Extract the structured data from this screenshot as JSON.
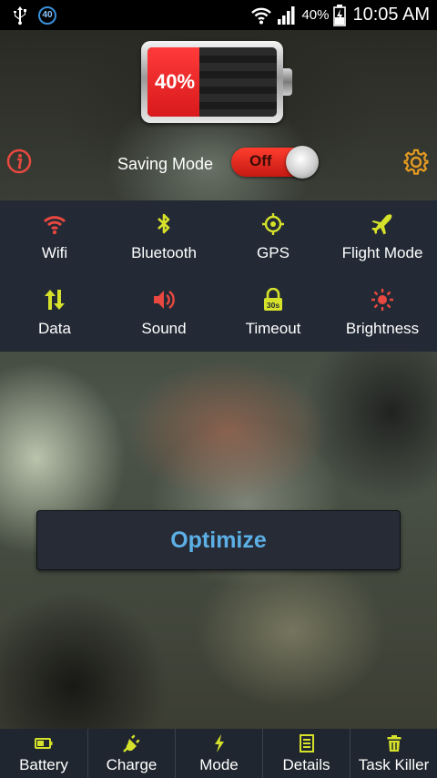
{
  "status_bar": {
    "notification_count": "40",
    "battery_percent": "40%",
    "time": "10:05 AM"
  },
  "battery": {
    "level_fraction": 0.4,
    "percent_label": "40%"
  },
  "saving_mode": {
    "label": "Saving Mode",
    "toggle_label": "Off"
  },
  "quick_settings": [
    {
      "label": "Wifi",
      "icon": "wifi-icon",
      "color": "#e8483f"
    },
    {
      "label": "Bluetooth",
      "icon": "bluetooth-icon",
      "color": "#d6e22a"
    },
    {
      "label": "GPS",
      "icon": "gps-icon",
      "color": "#d6e22a"
    },
    {
      "label": "Flight Mode",
      "icon": "airplane-icon",
      "color": "#d6e22a"
    },
    {
      "label": "Data",
      "icon": "data-arrows-icon",
      "color": "#d6e22a"
    },
    {
      "label": "Sound",
      "icon": "speaker-icon",
      "color": "#e8483f"
    },
    {
      "label": "Timeout",
      "icon": "timeout-lock-icon",
      "color": "#d6e22a",
      "badge": "30s"
    },
    {
      "label": "Brightness",
      "icon": "brightness-icon",
      "color": "#e8483f"
    }
  ],
  "optimize_label": "Optimize",
  "bottom_nav": [
    {
      "label": "Battery",
      "icon": "battery-icon"
    },
    {
      "label": "Charge",
      "icon": "plug-icon"
    },
    {
      "label": "Mode",
      "icon": "lightning-icon"
    },
    {
      "label": "Details",
      "icon": "list-icon"
    },
    {
      "label": "Task Killer",
      "icon": "trash-icon"
    }
  ],
  "colors": {
    "accent_yellow": "#d6e22a",
    "accent_red": "#e8483f",
    "optimize_text": "#5cb0e6",
    "panel": "#232a35"
  }
}
